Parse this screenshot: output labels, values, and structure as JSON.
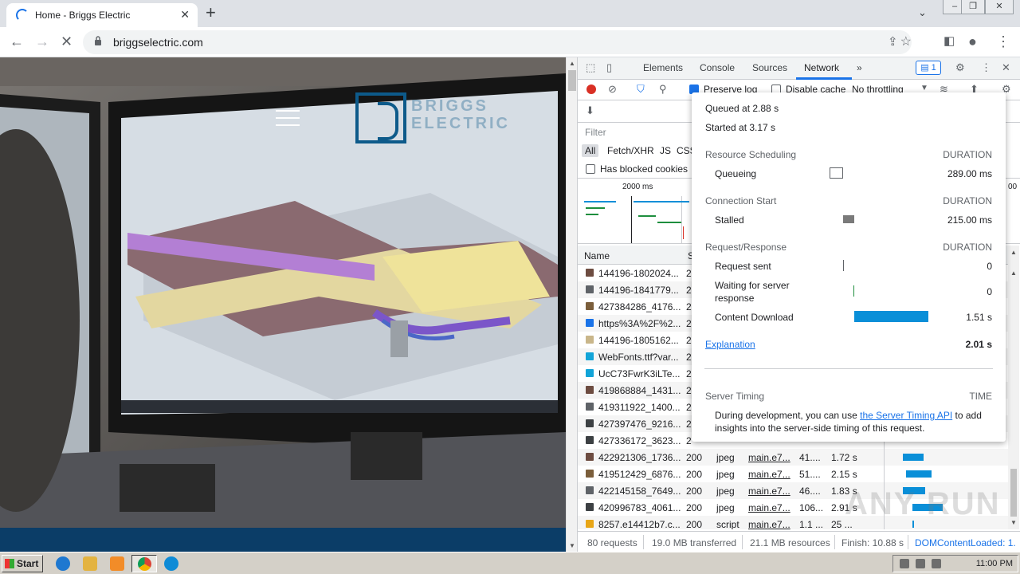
{
  "browser": {
    "tab_title": "Home - Briggs Electric",
    "url": "briggselectric.com"
  },
  "site": {
    "logo_text_line1": "BRIGGS",
    "logo_text_line2": "ELECTRIC"
  },
  "devtools": {
    "tabs": [
      "Elements",
      "Console",
      "Sources",
      "Network"
    ],
    "active_tab": "Network",
    "issues_badge": "1",
    "toolbar": {
      "preserve_log": "Preserve log",
      "disable_cache": "Disable cache",
      "throttling": "No throttling"
    },
    "filter_placeholder": "Filter",
    "type_filters": [
      "All",
      "Fetch/XHR",
      "JS",
      "CSS"
    ],
    "has_blocked_cookies": "Has blocked cookies",
    "overview_tick": "2000 ms",
    "overview_tick_right": "00",
    "columns": {
      "name": "Name",
      "status": "S"
    },
    "rows": [
      {
        "name": "144196-1802024...",
        "status": "2",
        "type": "",
        "initiator": "",
        "size": "",
        "time": "",
        "icon": "#6d4c41"
      },
      {
        "name": "144196-1841779...",
        "status": "2",
        "type": "",
        "initiator": "",
        "size": "",
        "time": "",
        "icon": "#5f6368"
      },
      {
        "name": "427384286_4176...",
        "status": "2",
        "type": "",
        "initiator": "",
        "size": "",
        "time": "",
        "icon": "#7b5e3b"
      },
      {
        "name": "https%3A%2F%2...",
        "status": "2",
        "type": "",
        "initiator": "",
        "size": "",
        "time": "",
        "icon": "#1a73e8"
      },
      {
        "name": "144196-1805162...",
        "status": "2",
        "type": "",
        "initiator": "",
        "size": "",
        "time": "",
        "icon": "#c9b68a"
      },
      {
        "name": "WebFonts.ttf?var...",
        "status": "2",
        "type": "",
        "initiator": "",
        "size": "",
        "time": "",
        "icon": "#12a4d8"
      },
      {
        "name": "UcC73FwrK3iLTe...",
        "status": "2",
        "type": "",
        "initiator": "",
        "size": "",
        "time": "",
        "icon": "#12a4d8"
      },
      {
        "name": "419868884_1431...",
        "status": "2",
        "type": "",
        "initiator": "",
        "size": "",
        "time": "",
        "icon": "#6d4c41"
      },
      {
        "name": "419311922_1400...",
        "status": "2",
        "type": "",
        "initiator": "",
        "size": "",
        "time": "",
        "icon": "#5f6368"
      },
      {
        "name": "427397476_9216...",
        "status": "2",
        "type": "",
        "initiator": "",
        "size": "",
        "time": "",
        "icon": "#3c4043"
      },
      {
        "name": "427336172_3623...",
        "status": "2",
        "type": "",
        "initiator": "",
        "size": "",
        "time": "",
        "icon": "#3c4043"
      },
      {
        "name": "422921306_1736...",
        "status": "200",
        "type": "jpeg",
        "initiator": "main.e7...",
        "size": "41....",
        "time": "1.72 s",
        "icon": "#6d4c41"
      },
      {
        "name": "419512429_6876...",
        "status": "200",
        "type": "jpeg",
        "initiator": "main.e7...",
        "size": "51....",
        "time": "2.15 s",
        "icon": "#7b5e3b"
      },
      {
        "name": "422145158_7649...",
        "status": "200",
        "type": "jpeg",
        "initiator": "main.e7...",
        "size": "46....",
        "time": "1.83 s",
        "icon": "#5f6368"
      },
      {
        "name": "420996783_4061...",
        "status": "200",
        "type": "jpeg",
        "initiator": "main.e7...",
        "size": "106...",
        "time": "2.91 s",
        "icon": "#3c4043"
      },
      {
        "name": "8257.e14412b7.c...",
        "status": "200",
        "type": "script",
        "initiator": "main.e7...",
        "size": "1.1 ...",
        "time": "25 ...",
        "icon": "#e8a617"
      }
    ],
    "status_bar": {
      "requests": "80 requests",
      "transferred": "19.0 MB transferred",
      "resources": "21.1 MB resources",
      "finish": "Finish: 10.88 s",
      "dom": "DOMContentLoaded: 1."
    }
  },
  "timing": {
    "queued": "Queued at 2.88 s",
    "started": "Started at 3.17 s",
    "resource_scheduling": "Resource Scheduling",
    "connection_start": "Connection Start",
    "request_response": "Request/Response",
    "duration_label": "DURATION",
    "queueing": {
      "label": "Queueing",
      "value": "289.00 ms"
    },
    "stalled": {
      "label": "Stalled",
      "value": "215.00 ms"
    },
    "request_sent": {
      "label": "Request sent",
      "value": "0"
    },
    "waiting_line1": "Waiting for server",
    "waiting_line2": "response",
    "waiting_value": "0",
    "content_download": {
      "label": "Content Download",
      "value": "1.51 s"
    },
    "explanation": "Explanation",
    "total": "2.01 s",
    "server_timing": "Server Timing",
    "time_label": "TIME",
    "server_timing_pre": "During development, you can use ",
    "server_timing_link": "the Server Timing API",
    "server_timing_post": " to add",
    "server_timing_line2": "insights into the server-side timing of this request."
  },
  "watermark": "ANY RUN",
  "taskbar": {
    "start": "Start",
    "clock": "11:00 PM"
  }
}
